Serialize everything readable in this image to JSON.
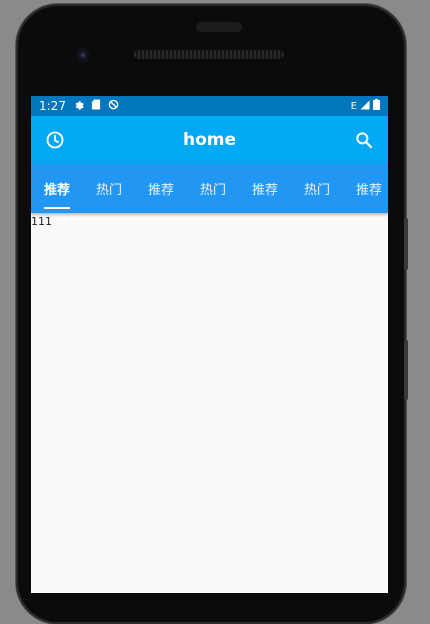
{
  "status_bar": {
    "time": "1:27",
    "right_text": "E",
    "icons": [
      "gear-icon",
      "sd-card-icon",
      "data-saver-icon",
      "signal-icon",
      "battery-icon"
    ]
  },
  "app_bar": {
    "title": "home",
    "left_icon": "clock-icon",
    "right_icon": "search-icon"
  },
  "tabs": [
    {
      "label": "推荐",
      "active": true
    },
    {
      "label": "热门"
    },
    {
      "label": "推荐"
    },
    {
      "label": "热门"
    },
    {
      "label": "推荐"
    },
    {
      "label": "热门"
    },
    {
      "label": "推荐"
    }
  ],
  "content": {
    "text": "111"
  },
  "colors": {
    "status_bar": "#0277bd",
    "app_bar": "#03a9f4",
    "tab_bar": "#2196f3",
    "background": "#fafafa"
  }
}
